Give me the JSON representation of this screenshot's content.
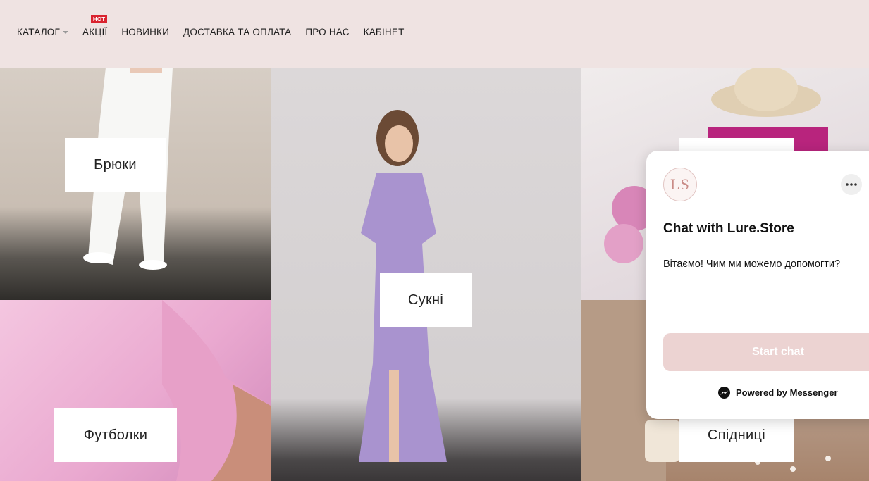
{
  "nav": {
    "catalog": "КАТАЛОГ",
    "sales": "АКЦІЇ",
    "hot_badge": "HOT",
    "new": "НОВИНКИ",
    "delivery": "ДОСТАВКА ТА ОПЛАТА",
    "about": "ПРО НАС",
    "cabinet": "КАБІНЕТ"
  },
  "categories": {
    "trousers": "Брюки",
    "dresses": "Сукні",
    "tshirts": "Футболки",
    "skirts": "Спідниці"
  },
  "chat": {
    "avatar_initials": "LS",
    "title": "Chat with Lure.Store",
    "message": "Вітаємо! Чим ми можемо допомогти?",
    "start_button": "Start chat",
    "powered_by": "Powered by Messenger"
  },
  "icons": [
    "chevron-down-icon",
    "more-options-icon",
    "messenger-icon"
  ],
  "colors": {
    "header_bg": "#efe3e2",
    "hot_badge": "#d9232f",
    "start_chat_button": "#ecd3d2"
  }
}
